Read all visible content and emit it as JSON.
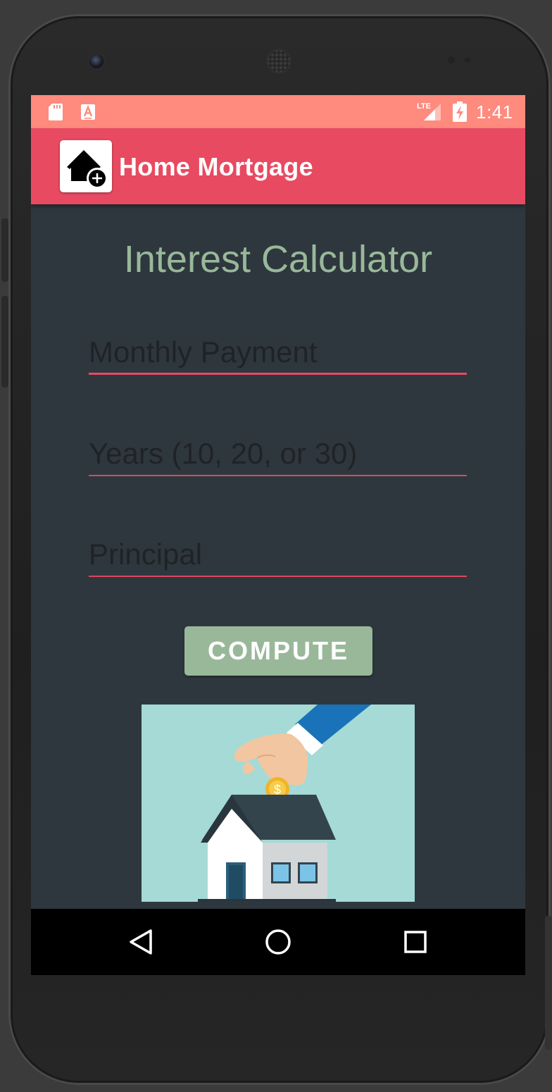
{
  "status_bar": {
    "time": "1:41",
    "icons": [
      "sd-card-icon",
      "a-notification-icon",
      "lte-signal-icon",
      "battery-charging-icon"
    ]
  },
  "app_bar": {
    "title": "Home Mortgage",
    "logo_icon": "home-add-icon"
  },
  "main": {
    "heading": "Interest Calculator",
    "fields": {
      "monthly_payment": {
        "placeholder": "Monthly Payment",
        "value": ""
      },
      "years": {
        "placeholder": "Years (10, 20, or 30)",
        "value": ""
      },
      "principal": {
        "placeholder": "Principal",
        "value": ""
      }
    },
    "compute_label": "COMPUTE",
    "illustration_icon": "house-coin-savings-illustration"
  },
  "nav_bar": {
    "icons": [
      "back-icon",
      "home-icon",
      "recents-icon"
    ]
  },
  "colors": {
    "status_bar": "#ff8a7e",
    "app_bar": "#e84a61",
    "background": "#2e373e",
    "heading": "#99b89a",
    "button": "#99b89a",
    "underline": "#e84a61",
    "illustration_bg": "#a5dad6"
  }
}
